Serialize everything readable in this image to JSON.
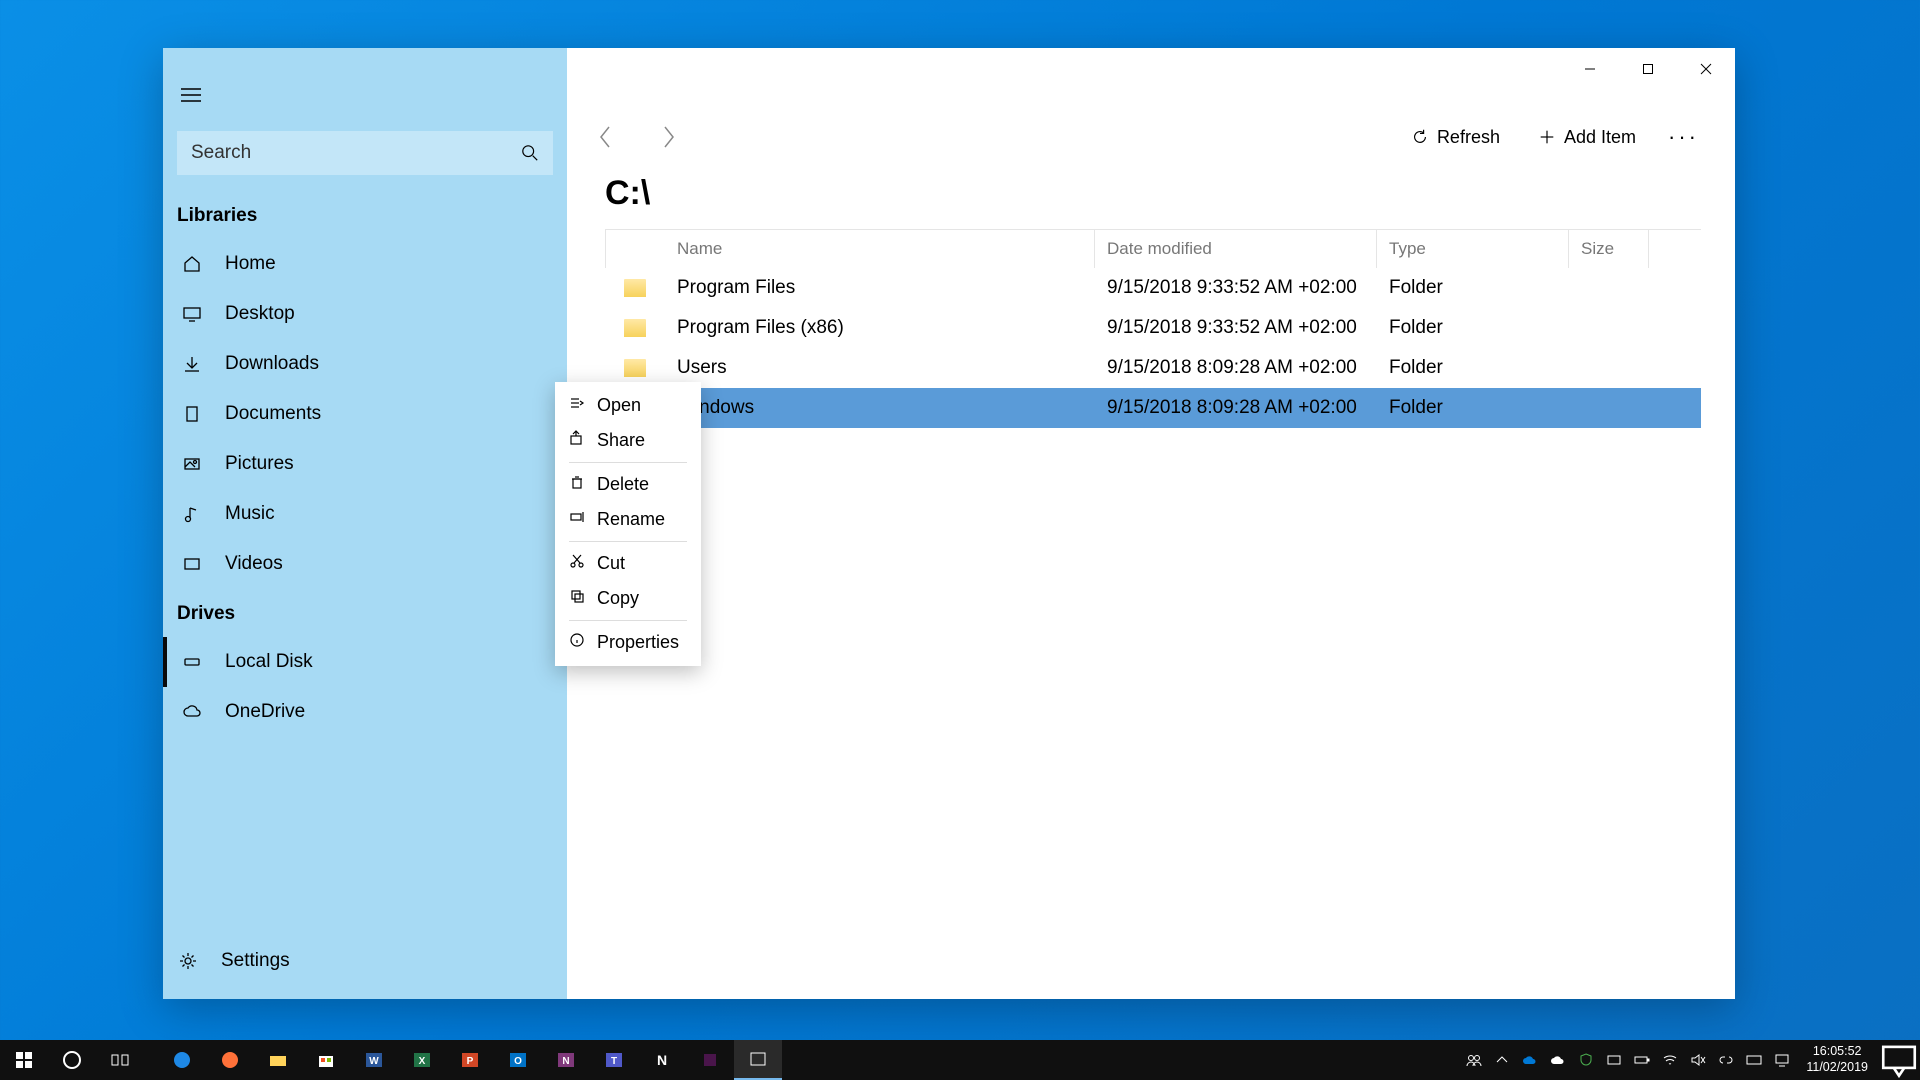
{
  "search": {
    "placeholder": "Search"
  },
  "sections": {
    "libraries_label": "Libraries",
    "drives_label": "Drives"
  },
  "sidebar": {
    "libraries": [
      {
        "label": "Home"
      },
      {
        "label": "Desktop"
      },
      {
        "label": "Downloads"
      },
      {
        "label": "Documents"
      },
      {
        "label": "Pictures"
      },
      {
        "label": "Music"
      },
      {
        "label": "Videos"
      }
    ],
    "drives": [
      {
        "label": "Local Disk",
        "active": true
      },
      {
        "label": "OneDrive"
      }
    ],
    "settings_label": "Settings"
  },
  "toolbar": {
    "refresh_label": "Refresh",
    "add_item_label": "Add Item"
  },
  "path": "C:\\",
  "columns": {
    "name": "Name",
    "date": "Date modified",
    "type": "Type",
    "size": "Size"
  },
  "rows": [
    {
      "name": "Program Files",
      "date": "9/15/2018 9:33:52 AM +02:00",
      "type": "Folder",
      "size": ""
    },
    {
      "name": "Program Files (x86)",
      "date": "9/15/2018 9:33:52 AM +02:00",
      "type": "Folder",
      "size": ""
    },
    {
      "name": "Users",
      "date": "9/15/2018 8:09:28 AM +02:00",
      "type": "Folder",
      "size": ""
    },
    {
      "name": "Windows",
      "date": "9/15/2018 8:09:28 AM +02:00",
      "type": "Folder",
      "size": "",
      "selected": true
    }
  ],
  "context_menu": [
    {
      "label": "Open"
    },
    {
      "label": "Share"
    },
    {
      "divider": true
    },
    {
      "label": "Delete"
    },
    {
      "label": "Rename"
    },
    {
      "divider": true
    },
    {
      "label": "Cut"
    },
    {
      "label": "Copy"
    },
    {
      "divider": true
    },
    {
      "label": "Properties"
    }
  ],
  "tray": {
    "time": "16:05:52",
    "date": "11/02/2019"
  }
}
